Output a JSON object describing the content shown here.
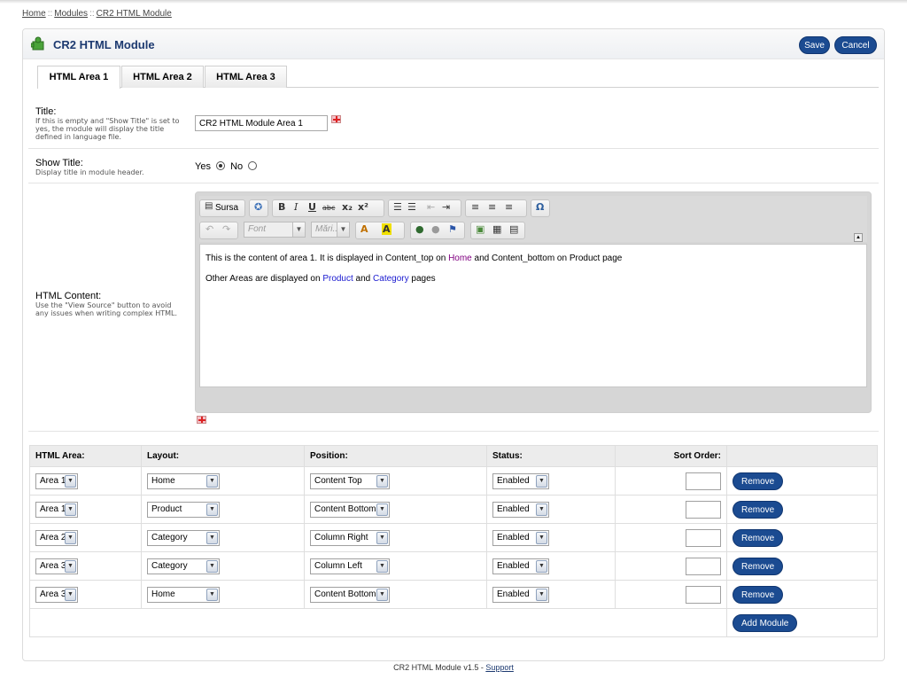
{
  "breadcrumb": {
    "items": [
      "Home",
      "Modules",
      "CR2 HTML Module"
    ],
    "separator": "::"
  },
  "header": {
    "title": "CR2 HTML Module",
    "save_label": "Save",
    "cancel_label": "Cancel"
  },
  "tabs": [
    {
      "label": "HTML Area 1",
      "active": true
    },
    {
      "label": "HTML Area 2",
      "active": false
    },
    {
      "label": "HTML Area 3",
      "active": false
    }
  ],
  "form": {
    "title_label": "Title:",
    "title_hint": "If this is empty and \"Show Title\" is set to yes, the module will display the title defined in language file.",
    "title_value": "CR2 HTML Module Area 1",
    "show_title_label": "Show Title:",
    "show_title_hint": "Display title in module header.",
    "yes_label": "Yes",
    "no_label": "No",
    "show_title_selected": "Yes",
    "html_content_label": "HTML Content:",
    "html_content_hint": "Use the \"View Source\" button to avoid any issues when writing complex HTML."
  },
  "editor": {
    "source_label": "Sursa",
    "font_placeholder": "Font",
    "size_placeholder": "Mări...",
    "line1_before": "This is the content of area 1. It is displayed in Content_top on ",
    "line1_link": "Home",
    "line1_after": " and Content_bottom on Product page",
    "line2_before": "Other Areas are displayed on ",
    "line2_link1": "Product",
    "line2_mid": " and ",
    "line2_link2": "Category",
    "line2_after": " pages"
  },
  "table": {
    "headers": [
      "HTML Area:",
      "Layout:",
      "Position:",
      "Status:",
      "Sort Order:"
    ],
    "rows": [
      {
        "area": "Area 1",
        "layout": "Home",
        "position": "Content Top",
        "status": "Enabled",
        "sort": ""
      },
      {
        "area": "Area 1",
        "layout": "Product",
        "position": "Content Bottom",
        "status": "Enabled",
        "sort": ""
      },
      {
        "area": "Area 2",
        "layout": "Category",
        "position": "Column Right",
        "status": "Enabled",
        "sort": ""
      },
      {
        "area": "Area 3",
        "layout": "Category",
        "position": "Column Left",
        "status": "Enabled",
        "sort": ""
      },
      {
        "area": "Area 3",
        "layout": "Home",
        "position": "Content Bottom",
        "status": "Enabled",
        "sort": ""
      }
    ],
    "remove_label": "Remove",
    "add_label": "Add Module"
  },
  "footer": {
    "text": "CR2 HTML Module v1.5 - ",
    "link": "Support"
  },
  "colors": {
    "accent": "#1b4b91",
    "title": "#1d3a70"
  }
}
